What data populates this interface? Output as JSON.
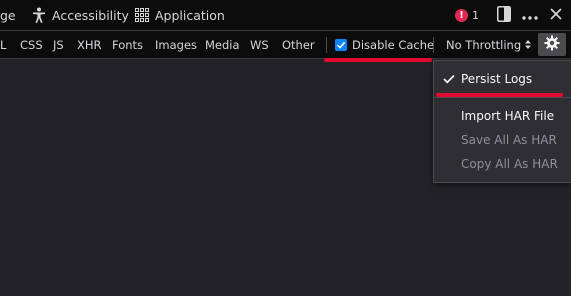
{
  "top_toolbar": {
    "tabs": [
      {
        "label": "ge"
      },
      {
        "label": "Accessibility"
      },
      {
        "label": "Application"
      }
    ],
    "error_count": "1"
  },
  "filter_bar": {
    "filters": [
      {
        "label": "L"
      },
      {
        "label": "CSS"
      },
      {
        "label": "JS"
      },
      {
        "label": "XHR"
      },
      {
        "label": "Fonts"
      },
      {
        "label": "Images"
      },
      {
        "label": "Media"
      },
      {
        "label": "WS"
      },
      {
        "label": "Other"
      }
    ],
    "disable_cache_label": "Disable Cache",
    "disable_cache_checked": true,
    "throttling_label": "No Throttling"
  },
  "settings_menu": {
    "persist_logs_label": "Persist Logs",
    "persist_logs_checked": true,
    "import_har_label": "Import HAR File",
    "save_all_har_label": "Save All As HAR",
    "copy_all_har_label": "Copy All As HAR"
  },
  "colors": {
    "accent": "#0a84ff",
    "annotation_underline": "#e30b2f",
    "error_badge": "#e22850"
  }
}
